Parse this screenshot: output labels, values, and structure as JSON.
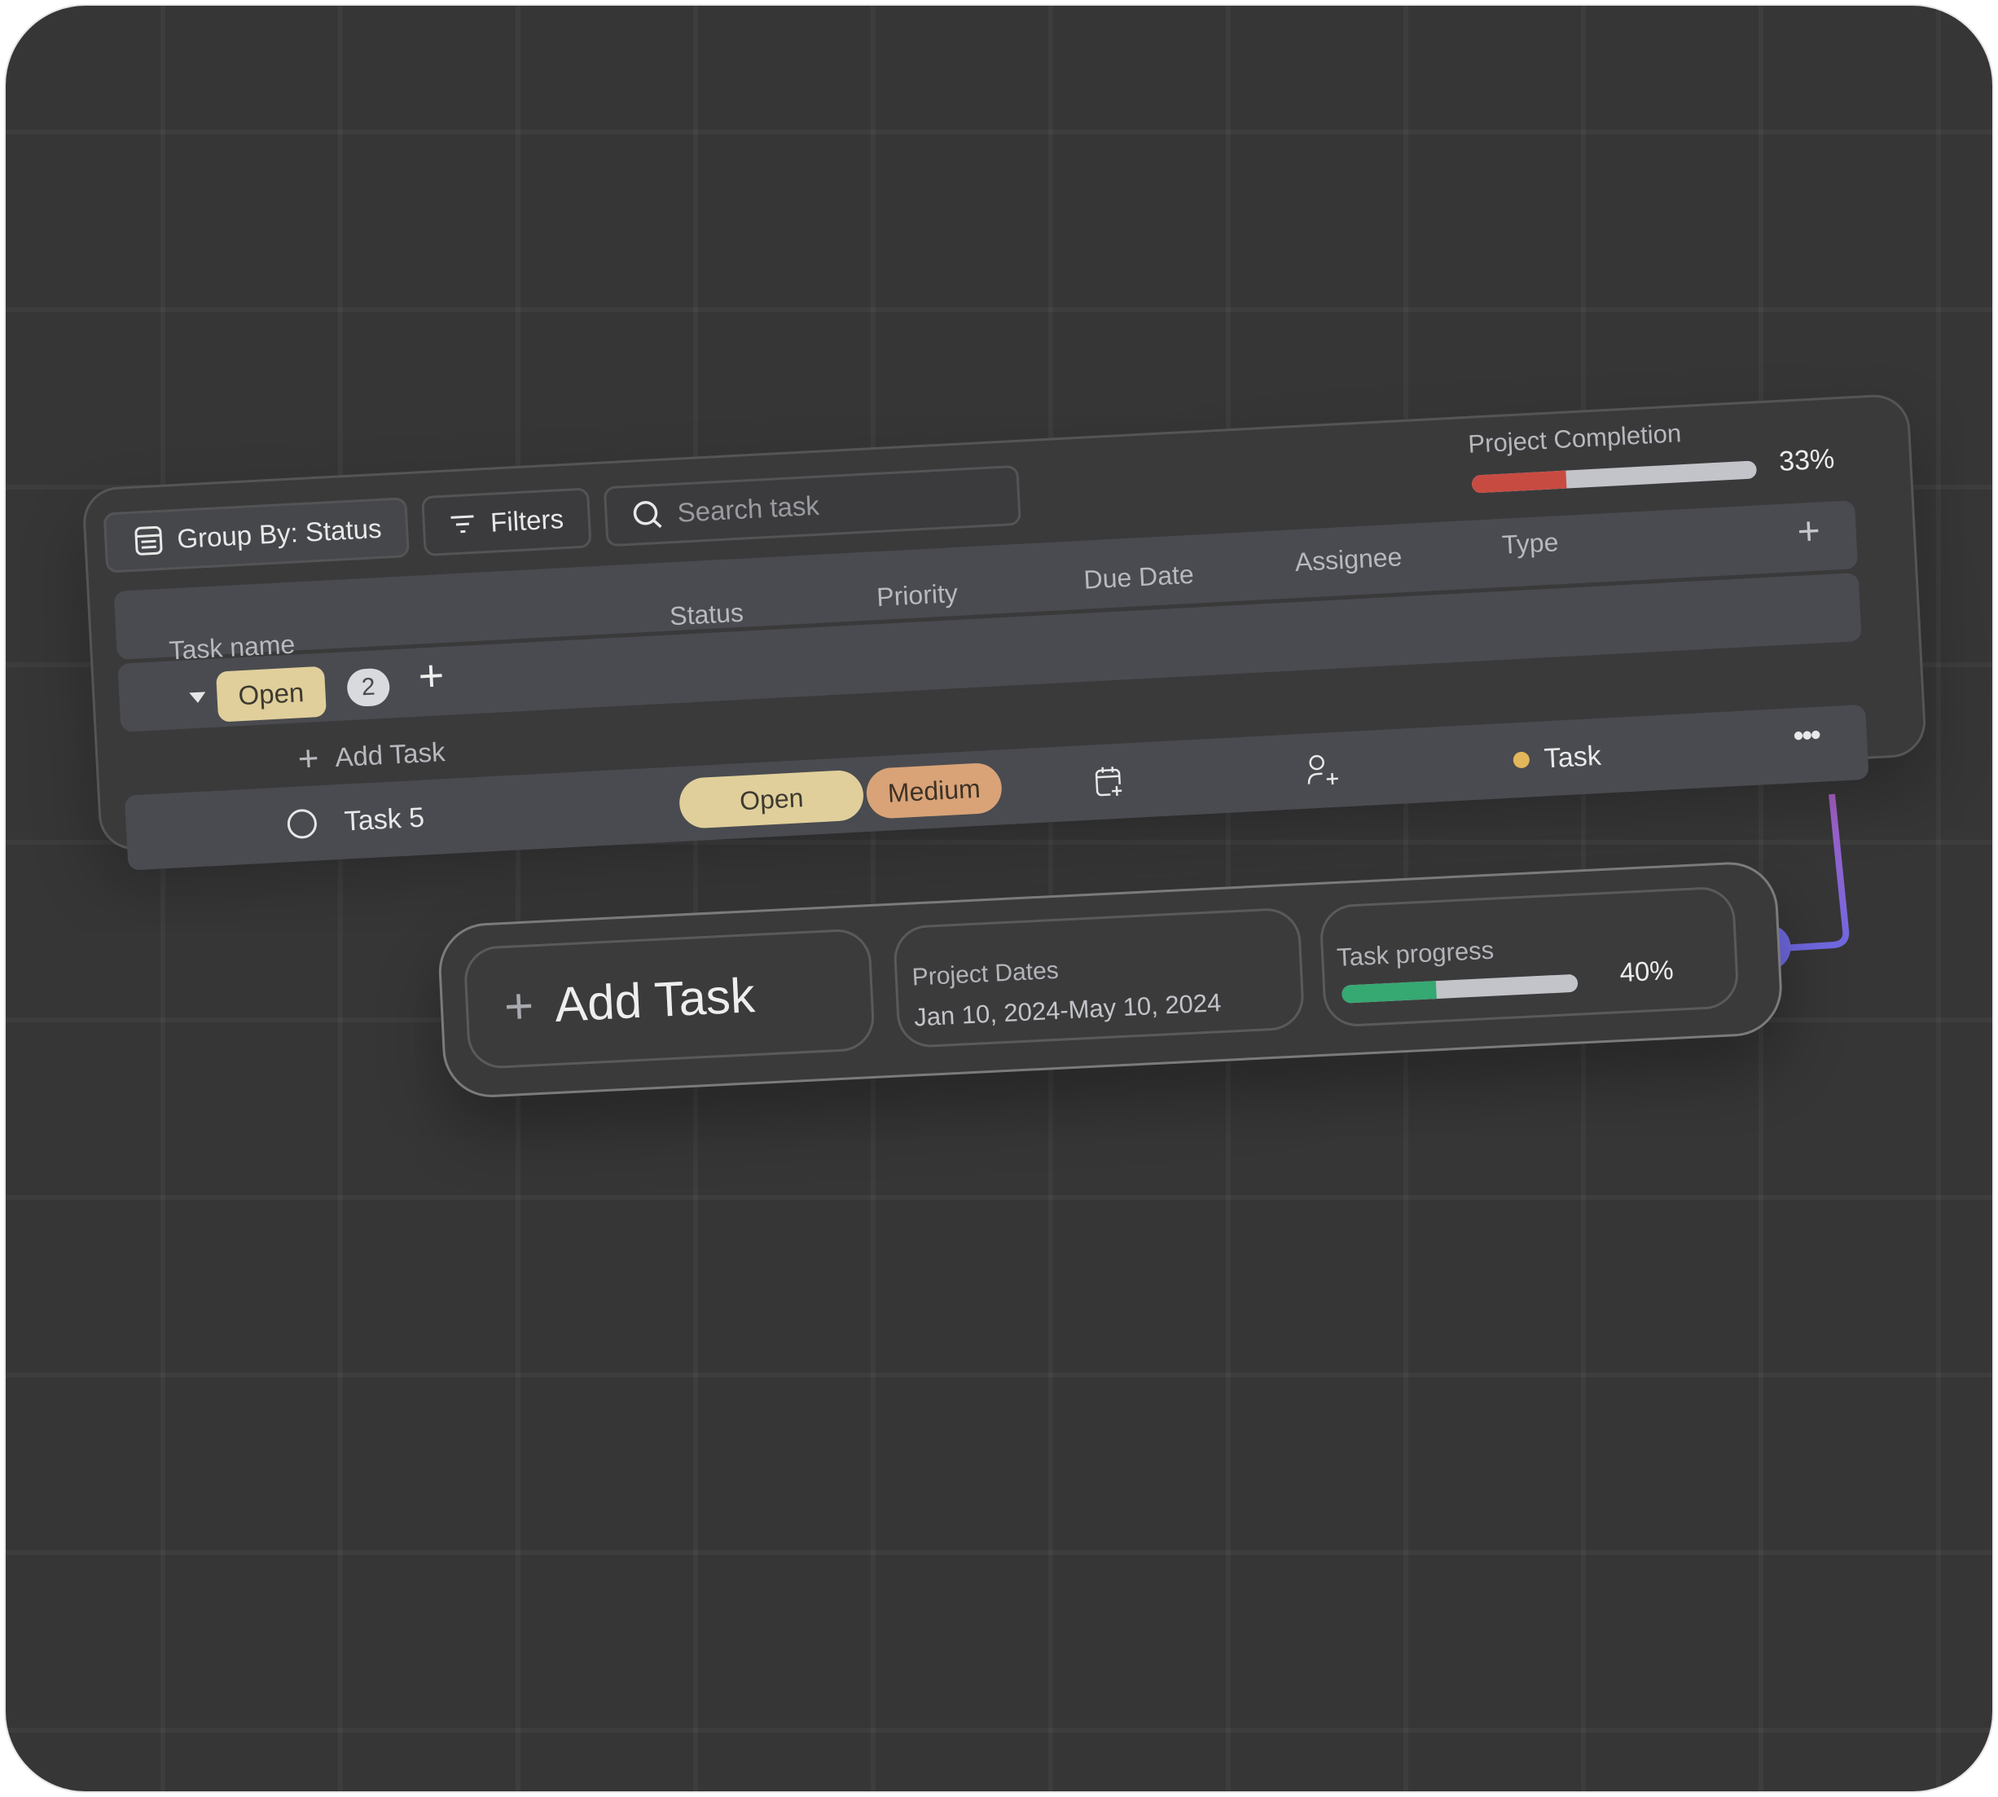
{
  "toolbar": {
    "group_by_label": "Group By: Status",
    "group_by_icon": "list-box-icon",
    "filters_label": "Filters",
    "filters_icon": "filter-icon",
    "search_placeholder": "Search task",
    "search_icon": "search-icon"
  },
  "project_completion": {
    "label": "Project Completion",
    "percent_text": "33%",
    "value": 0.33,
    "fill_color": "#c84b42",
    "track_color": "#c2c4ca"
  },
  "table": {
    "columns": {
      "task_name": "Task name",
      "status": "Status",
      "priority": "Priority",
      "due_date": "Due Date",
      "assignee": "Assignee",
      "type": "Type"
    },
    "add_column_label": "+",
    "group": {
      "label": "Open",
      "count": "2",
      "add_label": "+",
      "color": "#e0cf9b"
    },
    "add_task_label": "Add Task",
    "rows": [
      {
        "name": "Task 5",
        "status": "Open",
        "priority": "Medium",
        "due_date_icon": "calendar-add-icon",
        "assignee_icon": "user-add-icon",
        "type": "Task",
        "type_color": "#e2b75b",
        "more_label": "•••"
      }
    ]
  },
  "summary_card": {
    "add_task_label": "Add Task",
    "project_dates_label": "Project Dates",
    "project_dates_value": "Jan 10, 2024-May 10, 2024",
    "task_progress_label": "Task progress",
    "task_progress_text": "40%",
    "task_progress_value": 0.4,
    "fill_color": "#36a872"
  },
  "connector_color_top": "#a660c4",
  "connector_color_bottom": "#6f68e0"
}
